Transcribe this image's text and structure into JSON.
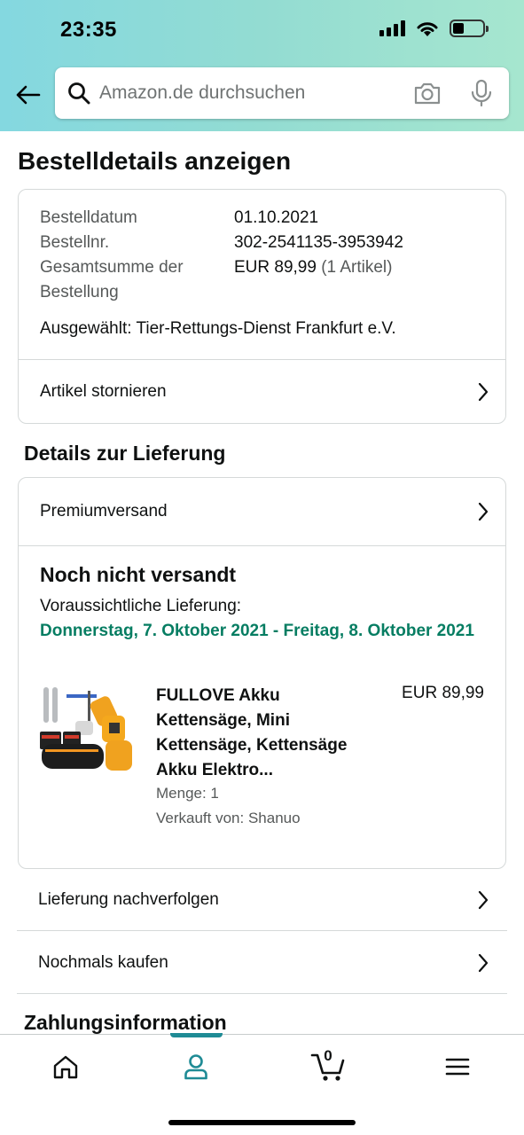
{
  "status_bar": {
    "time": "23:35"
  },
  "search": {
    "placeholder": "Amazon.de durchsuchen"
  },
  "page": {
    "title": "Bestelldetails anzeigen"
  },
  "order_summary": {
    "date_label": "Bestelldatum",
    "date_value": "01.10.2021",
    "number_label": "Bestellnr.",
    "number_value": "302-2541135-3953942",
    "total_label_line1": "Gesamtsumme der",
    "total_label_line2": "Bestellung",
    "total_value": "EUR 89,99",
    "total_items": "(1 Artikel)",
    "selected": "Ausgewählt: Tier-Rettungs-Dienst Frankfurt e.V.",
    "cancel_label": "Artikel stornieren"
  },
  "delivery": {
    "section_title": "Details zur Lieferung",
    "shipping_method": "Premiumversand",
    "status": "Noch nicht versandt",
    "expected_label": "Voraussichtliche Lieferung:",
    "expected_range": "Donnerstag, 7. Oktober 2021 - Freitag, 8. Oktober 2021",
    "product": {
      "title": "FULLOVE Akku Kettensäge, Mini Kettensäge, Kettensäge Akku Elektro...",
      "price": "EUR 89,99",
      "quantity": "Menge: 1",
      "seller": "Verkauft von: Shanuo"
    }
  },
  "actions": {
    "track": "Lieferung nachverfolgen",
    "buy_again": "Nochmals kaufen"
  },
  "payment": {
    "section_title": "Zahlungsinformation"
  },
  "bottom_nav": {
    "cart_count": "0",
    "active": "account"
  },
  "colors": {
    "accent_teal": "#1f8b95",
    "delivery_green": "#067d62",
    "header_gradient_start": "#84d8e0",
    "header_gradient_end": "#a6e6cf"
  },
  "icons": [
    "back-arrow-icon",
    "search-icon",
    "camera-icon",
    "mic-icon",
    "chevron-right-icon",
    "home-icon",
    "user-icon",
    "cart-icon",
    "menu-icon"
  ]
}
